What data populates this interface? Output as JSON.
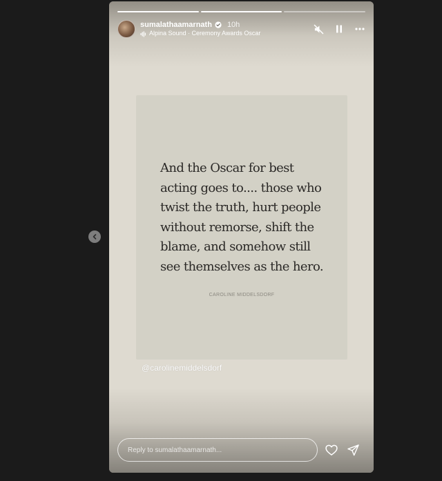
{
  "story": {
    "progress": [
      1,
      1,
      0
    ],
    "user": {
      "username": "sumalathaamarnath",
      "time": "10h"
    },
    "audio": {
      "label": "Alpina Sound · Ceremony Awards Oscar"
    },
    "controls": {
      "mute_icon": "muted-speaker-icon",
      "pause_icon": "pause-icon",
      "more_icon": "more-options-icon"
    },
    "quote": {
      "lines": [
        "And the Oscar for best",
        "acting goes to.... those who",
        "twist the truth, hurt people",
        "without remorse, shift the",
        "blame, and somehow still",
        "see themselves as the hero."
      ],
      "author": "CAROLINE MIDDELSDORF"
    },
    "mention": "@carolinemiddelsdorf",
    "reply": {
      "placeholder": "Reply to sumalathaamarnath..."
    },
    "footer": {
      "like_icon": "heart-icon",
      "share_icon": "send-icon"
    }
  },
  "nav": {
    "prev_icon": "chevron-left-icon"
  },
  "colors": {
    "page_bg": "#1b1b1b",
    "story_bg": "#dedad0",
    "card_bg": "#d3d1c6",
    "quote_text": "#2a2826"
  }
}
